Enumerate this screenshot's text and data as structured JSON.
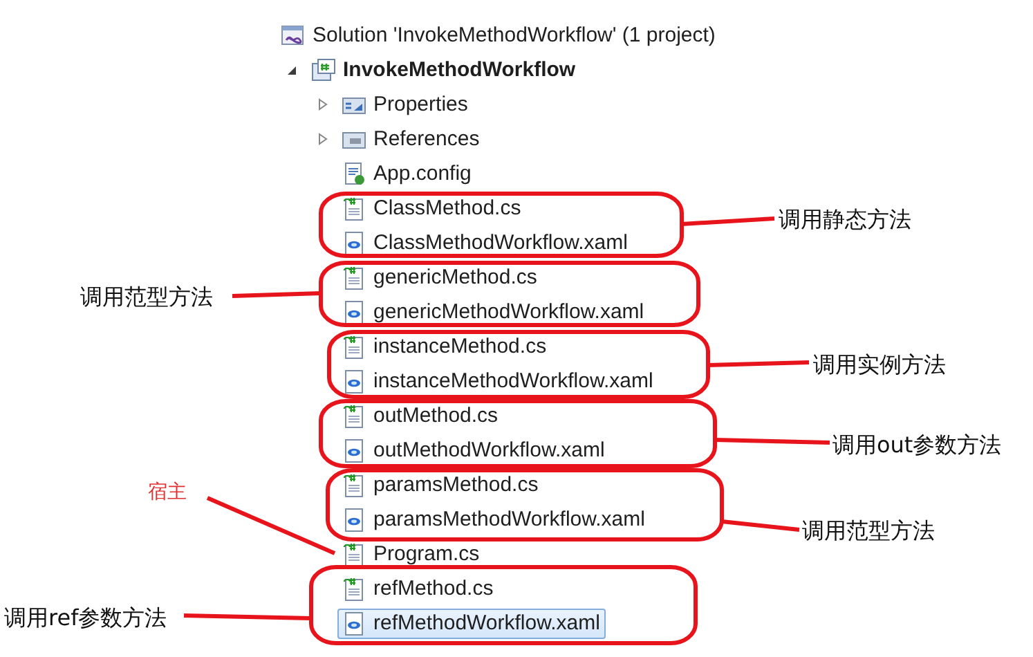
{
  "solution": {
    "label": "Solution 'InvokeMethodWorkflow' (1 project)",
    "kind": "solution",
    "children": [
      {
        "label": "InvokeMethodWorkflow",
        "kind": "project",
        "expanded": true,
        "children": [
          {
            "label": "Properties",
            "kind": "properties",
            "expanded": false
          },
          {
            "label": "References",
            "kind": "references",
            "expanded": false
          },
          {
            "label": "App.config",
            "kind": "config"
          },
          {
            "label": "ClassMethod.cs",
            "kind": "cs"
          },
          {
            "label": "ClassMethodWorkflow.xaml",
            "kind": "xaml"
          },
          {
            "label": "genericMethod.cs",
            "kind": "cs"
          },
          {
            "label": "genericMethodWorkflow.xaml",
            "kind": "xaml"
          },
          {
            "label": "instanceMethod.cs",
            "kind": "cs"
          },
          {
            "label": "instanceMethodWorkflow.xaml",
            "kind": "xaml"
          },
          {
            "label": "outMethod.cs",
            "kind": "cs"
          },
          {
            "label": "outMethodWorkflow.xaml",
            "kind": "xaml"
          },
          {
            "label": "paramsMethod.cs",
            "kind": "cs"
          },
          {
            "label": "paramsMethodWorkflow.xaml",
            "kind": "xaml"
          },
          {
            "label": "Program.cs",
            "kind": "cs"
          },
          {
            "label": "refMethod.cs",
            "kind": "cs"
          },
          {
            "label": "refMethodWorkflow.xaml",
            "kind": "xaml",
            "selected": true
          }
        ]
      }
    ]
  },
  "annotations": [
    {
      "label": "调用静态方法",
      "kind": "group"
    },
    {
      "label": "调用范型方法",
      "kind": "group"
    },
    {
      "label": "调用实例方法",
      "kind": "group"
    },
    {
      "label": "调用out参数方法",
      "kind": "group"
    },
    {
      "label": "宿主",
      "kind": "pointer"
    },
    {
      "label": "调用范型方法",
      "kind": "group"
    },
    {
      "label": "调用ref参数方法",
      "kind": "group"
    }
  ]
}
